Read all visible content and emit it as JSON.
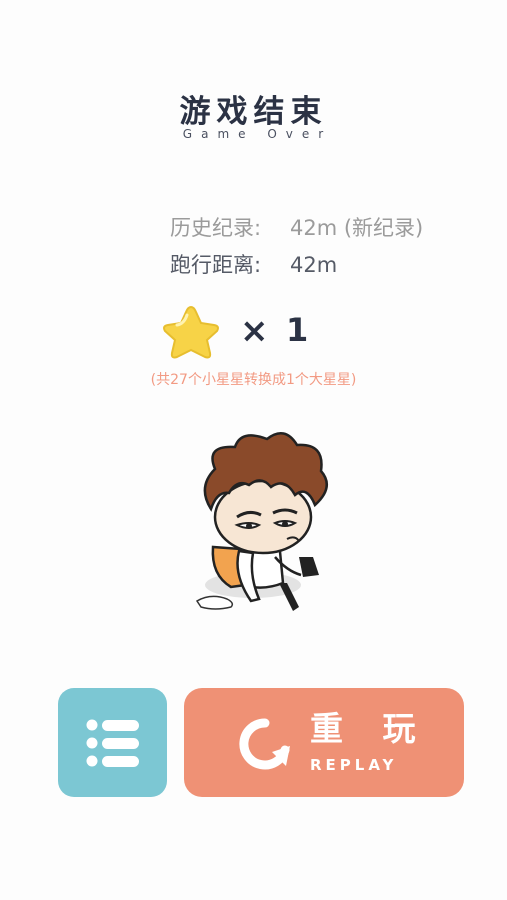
{
  "header": {
    "title": "游戏结束",
    "subtitle": "Game Over"
  },
  "stats": {
    "best_label": "历史纪录:",
    "best_value": "42m (新纪录)",
    "distance_label": "跑行距离:",
    "distance_value": "42m"
  },
  "reward": {
    "times_symbol": "×",
    "big_star_count": "1",
    "note": "(共27个小星星转换成1个大星星)"
  },
  "buttons": {
    "replay_label_zh": "重 玩",
    "replay_label_en": "REPLAY"
  },
  "colors": {
    "menu_button": "#7cc7d3",
    "replay_button": "#ef9175",
    "star": "#f7d347",
    "note_text": "#f29a83",
    "title_text": "#2b3244"
  },
  "icons": {
    "star": "star-icon",
    "menu": "list-icon",
    "replay": "refresh-icon"
  }
}
